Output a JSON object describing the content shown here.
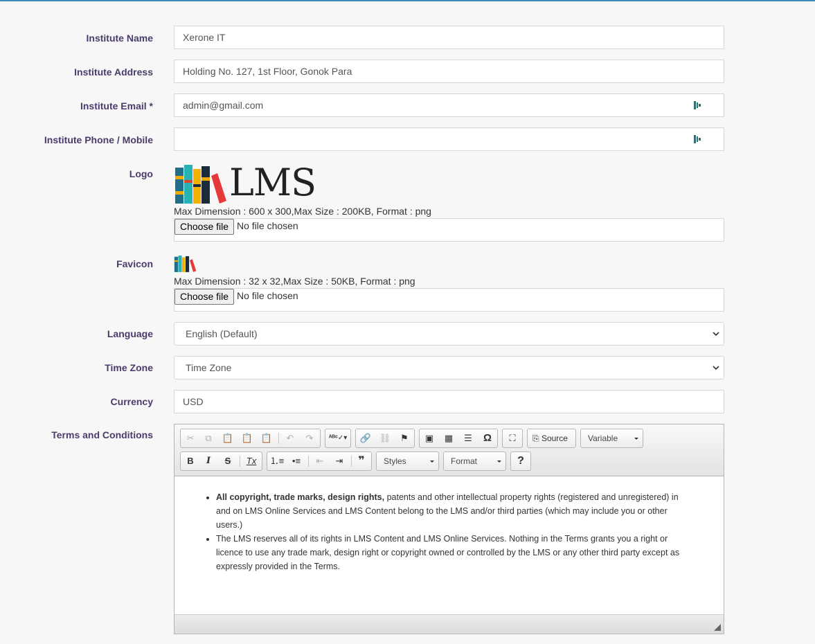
{
  "form": {
    "institute_name": {
      "label": "Institute Name",
      "value": "Xerone IT"
    },
    "institute_address": {
      "label": "Institute Address",
      "value": "Holding No. 127, 1st Floor, Gonok Para"
    },
    "institute_email": {
      "label": "Institute Email *",
      "value": "admin@gmail.com"
    },
    "institute_phone": {
      "label": "Institute Phone / Mobile",
      "value": ""
    },
    "logo": {
      "label": "Logo",
      "logo_text": "LMS",
      "hint": "Max Dimension : 600 x 300,Max Size : 200KB, Format : png",
      "button": "Choose file",
      "status": "No file chosen"
    },
    "favicon": {
      "label": "Favicon",
      "hint": "Max Dimension : 32 x 32,Max Size : 50KB, Format : png",
      "button": "Choose file",
      "status": "No file chosen"
    },
    "language": {
      "label": "Language",
      "selected": "English (Default)"
    },
    "time_zone": {
      "label": "Time Zone",
      "selected": "Time Zone"
    },
    "currency": {
      "label": "Currency",
      "value": "USD"
    },
    "terms": {
      "label": "Terms and Conditions",
      "toolbar": {
        "source": "Source",
        "variable": "Variable",
        "styles": "Styles",
        "format": "Format",
        "help": "?"
      },
      "items": [
        {
          "bold": "All copyright, trade marks, design rights,",
          "text": " patents and other intellectual property rights (registered and unregistered) in and on LMS Online Services and LMS Content belong to the LMS and/or third parties (which may include you or other users.)"
        },
        {
          "bold": "",
          "text": "The LMS reserves all of its rights in LMS Content and LMS Online Services. Nothing in the Terms grants you a right or licence to use any trade mark, design right or copyright owned or controlled by the LMS or any other third party except as expressly provided in the Terms."
        }
      ]
    }
  },
  "colors": {
    "label": "#4b3b6b",
    "accent_top": "#3c8dbc",
    "key_icon": "#2e6f73"
  }
}
